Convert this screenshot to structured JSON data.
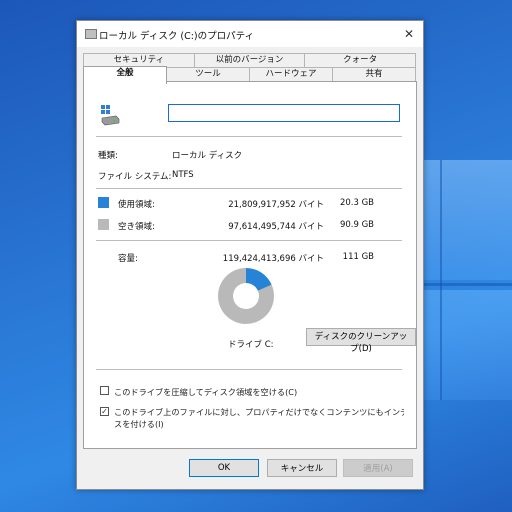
{
  "dialog": {
    "title": "ローカル ディスク (C:)のプロパティ",
    "close_glyph": "✕"
  },
  "tabs": {
    "row_top": [
      "セキュリティ",
      "以前のバージョン",
      "クォータ"
    ],
    "row_bottom": [
      "全般",
      "ツール",
      "ハードウェア",
      "共有"
    ],
    "active": "全般"
  },
  "general": {
    "drive_name_value": "",
    "type_label": "種類:",
    "type_value": "ローカル ディスク",
    "fs_label": "ファイル システム:",
    "fs_value": "NTFS",
    "used_label": "使用領域:",
    "used_bytes": "21,809,917,952 バイト",
    "used_gb": "20.3 GB",
    "free_label": "空き領域:",
    "free_bytes": "97,614,495,744 バイト",
    "free_gb": "90.9 GB",
    "capacity_label": "容量:",
    "capacity_bytes": "119,424,413,696 バイト",
    "capacity_gb": "111 GB",
    "drive_label": "ドライブ C:",
    "cleanup_button": "ディスクのクリーンアップ(D)",
    "used_fraction": 0.183,
    "used_color": "#2683d6",
    "free_color": "#b9b9b9",
    "compress_label": "このドライブを圧縮してディスク領域を空ける(C)",
    "compress_checked": false,
    "index_label_line1": "このドライブ上のファイルに対し、プロパティだけでなくコンテンツにもインデックス",
    "index_label_line2": "スを付ける(I)",
    "index_checked": true
  },
  "buttons": {
    "ok": "OK",
    "cancel": "キャンセル",
    "apply": "適用(A)"
  }
}
